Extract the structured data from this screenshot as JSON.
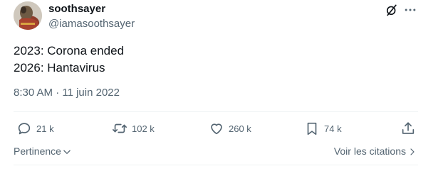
{
  "author": {
    "name": "soothsayer",
    "handle": "@iamasoothsayer"
  },
  "tweet": {
    "lines": [
      "2023: Corona ended",
      "2026: Hantavirus"
    ],
    "timestamp": "8:30 AM · 11 juin 2022"
  },
  "actions": {
    "replies": "21 k",
    "reposts": "102 k",
    "likes": "260 k",
    "bookmarks": "74 k"
  },
  "footer": {
    "sort_label": "Pertinence",
    "quotes_label": "Voir les citations"
  },
  "icons": {
    "grok": "grok-slash-icon",
    "more": "more-icon",
    "reply": "reply-icon",
    "repost": "repost-icon",
    "like": "heart-icon",
    "bookmark": "bookmark-icon",
    "share": "share-icon"
  },
  "colors": {
    "text": "#0f1419",
    "secondary": "#536471",
    "divider": "#eff3f4"
  }
}
